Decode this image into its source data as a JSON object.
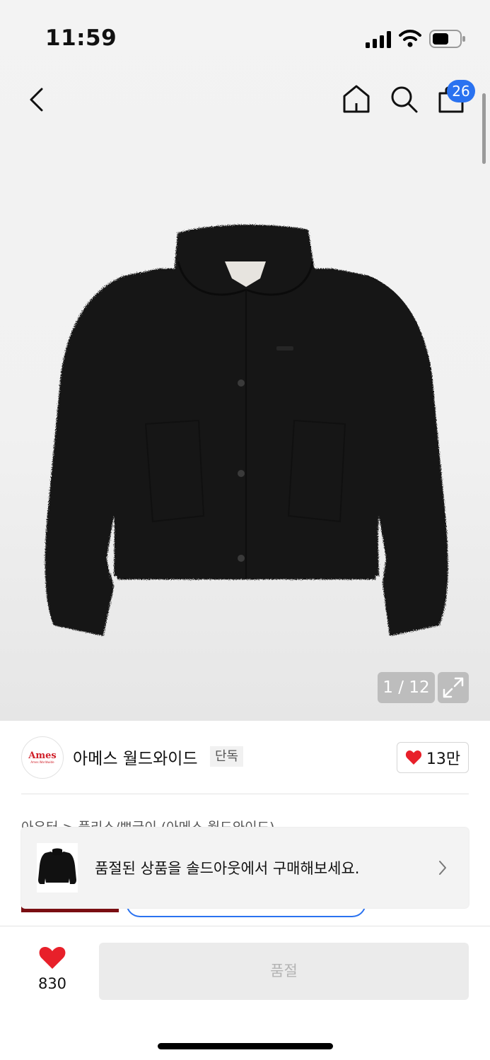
{
  "status_bar": {
    "time": "11:59"
  },
  "nav": {
    "back_icon": "chevron-left-icon",
    "home_icon": "home-icon",
    "search_icon": "search-icon",
    "cart_icon": "shopping-bag-icon",
    "cart_count": "26"
  },
  "gallery": {
    "counter": "1 / 12",
    "expand_icon": "expand-icon"
  },
  "brand": {
    "logo_text": "Ames",
    "logo_subtext": "Ames Worldwide",
    "name": "아메스 월드와이드",
    "badge": "단독",
    "like_count": "13만"
  },
  "breadcrumb": "아우터  >  플리스/뽀글이 (아메스 월드와이드)",
  "soldout_banner": {
    "text": "품절된 상품을 솔드아웃에서 구매해보세요."
  },
  "bottom_bar": {
    "like_count": "830",
    "buy_label": "품절"
  },
  "colors": {
    "accent_blue": "#2a72f0",
    "heart_red": "#e8202a",
    "logo_red": "#d0202a"
  }
}
